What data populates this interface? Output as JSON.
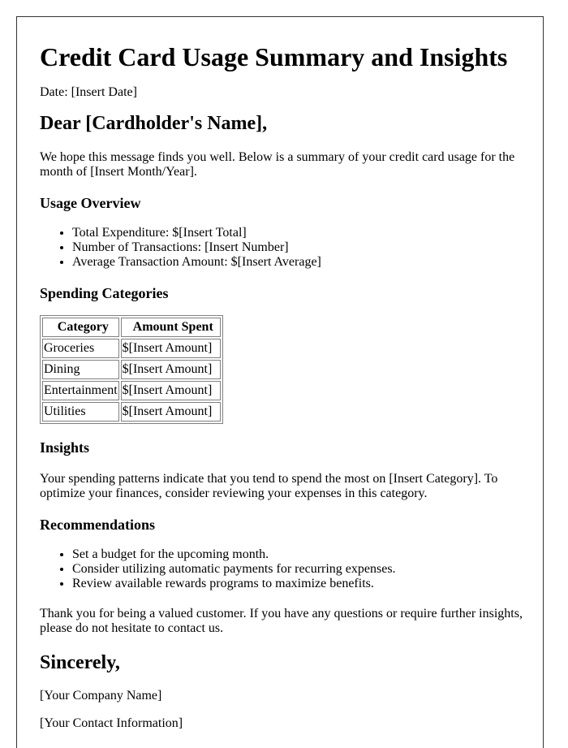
{
  "document": {
    "title": "Credit Card Usage Summary and Insights",
    "date_line": "Date: [Insert Date]",
    "salutation": "Dear [Cardholder's Name],",
    "intro": "We hope this message finds you well. Below is a summary of your credit card usage for the month of [Insert Month/Year].",
    "usage_overview": {
      "heading": "Usage Overview",
      "items": [
        "Total Expenditure: $[Insert Total]",
        "Number of Transactions: [Insert Number]",
        "Average Transaction Amount: $[Insert Average]"
      ]
    },
    "spending_categories": {
      "heading": "Spending Categories",
      "columns": [
        "Category",
        "Amount Spent"
      ],
      "rows": [
        [
          "Groceries",
          "$[Insert Amount]"
        ],
        [
          "Dining",
          "$[Insert Amount]"
        ],
        [
          "Entertainment",
          "$[Insert Amount]"
        ],
        [
          "Utilities",
          "$[Insert Amount]"
        ]
      ]
    },
    "insights": {
      "heading": "Insights",
      "text": "Your spending patterns indicate that you tend to spend the most on [Insert Category]. To optimize your finances, consider reviewing your expenses in this category."
    },
    "recommendations": {
      "heading": "Recommendations",
      "items": [
        "Set a budget for the upcoming month.",
        "Consider utilizing automatic payments for recurring expenses.",
        "Review available rewards programs to maximize benefits."
      ]
    },
    "closing_text": "Thank you for being a valued customer. If you have any questions or require further insights, please do not hesitate to contact us.",
    "signoff": "Sincerely,",
    "company": "[Your Company Name]",
    "contact": "[Your Contact Information]"
  }
}
